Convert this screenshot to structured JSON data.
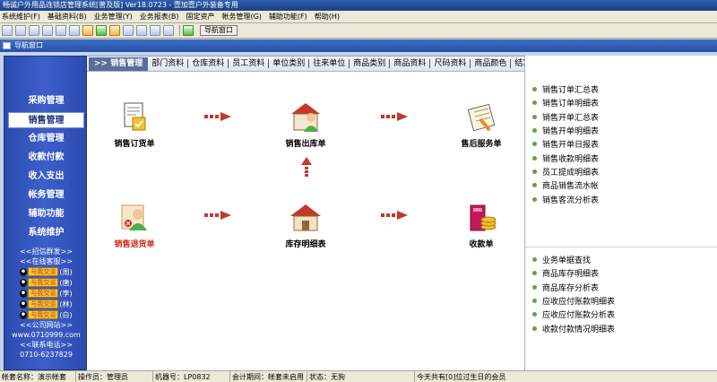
{
  "app": {
    "title": "畅诚户外用品连锁店管理系统[普及版] Ver18.0723 - 壹加壹户外装备专用"
  },
  "menu": [
    "系统维护(F)",
    "基础资料(B)",
    "业务管理(Y)",
    "业务报表(B)",
    "固定资产",
    "帐务管理(G)",
    "辅助功能(F)",
    "帮助(H)"
  ],
  "toolbar": {
    "icons": [
      "new-doc-icon",
      "open-icon",
      "save-icon",
      "copy-icon",
      "print-icon",
      "preview-icon",
      "users-icon",
      "user-icon",
      "money-icon",
      "chart-icon",
      "stamp-icon",
      "printer-icon",
      "help-icon",
      "exit-icon"
    ],
    "nav_window_label": "导航窗口"
  },
  "child_window": {
    "title": "导航窗口"
  },
  "sidebar": {
    "items": [
      "采购管理",
      "销售管理",
      "仓库管理",
      "收款付款",
      "收入支出",
      "帐务管理",
      "辅助功能",
      "系统维护"
    ],
    "active_index": 1,
    "group_line": "<<招信群发>>",
    "service_line": "<<在线客服>>",
    "qq_badge": "与我交谈",
    "qq_names": [
      "(周)",
      "(唐)",
      "(李)",
      "(林)",
      "(白)"
    ],
    "website_label": "<<公司网站>>",
    "website": "www.0710999.com",
    "phone_label": "<<联系电话>>",
    "phone": "0710-6237829"
  },
  "tabbar": {
    "current": ">> 销售管理",
    "links": [
      "部门资料",
      "仓库资料",
      "员工资料",
      "单位类别",
      "往来单位",
      "商品类别",
      "商品资料",
      "尺码资料",
      "商品颜色",
      "结算方式"
    ]
  },
  "flow": {
    "order": "销售订货单",
    "outbound": "销售出库单",
    "aftersale": "售后服务单",
    "returns": "销售退货单",
    "stock": "库存明细表",
    "receipt": "收款单"
  },
  "reports_top": [
    "销售订单汇总表",
    "销售订单明细表",
    "销售开单汇总表",
    "销售开单明细表",
    "销售开单日报表",
    "销售收款明细表",
    "员工提成明细表",
    "商品销售流水帐",
    "销售客流分析表"
  ],
  "reports_bottom": [
    "业务单据查找",
    "商品库存明细表",
    "商品库存分析表",
    "应收应付账款明细表",
    "应收应付账款分析表",
    "收款付款情况明细表"
  ],
  "status": {
    "account": "帐套名称：演示帐套",
    "operator": "操作员：管理员",
    "machine": "机器号：LP0832",
    "period": "会计期间：帐套未启用",
    "state": "状态：无狗",
    "birthday": "今天共有[0]位过生日的会员"
  },
  "colors": {
    "sidebar_bg": "#3c5fc9",
    "title_bar": "#2f5fb0",
    "accent_red": "#d0281c",
    "arrow": "#c0392b"
  }
}
